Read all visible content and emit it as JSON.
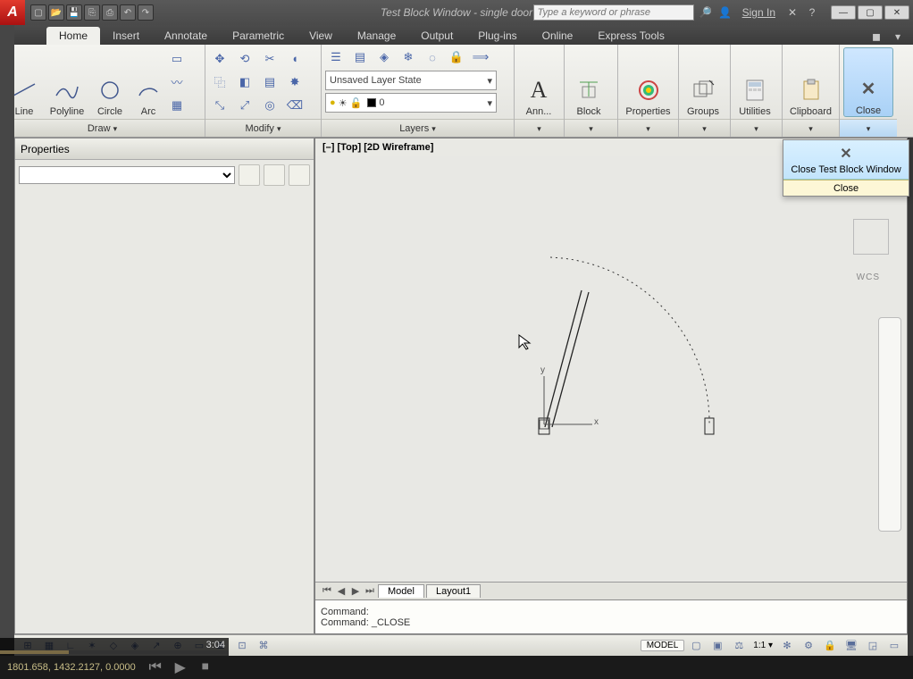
{
  "window": {
    "title": "Test Block Window - single door",
    "search_placeholder": "Type a keyword or phrase",
    "signin": "Sign In"
  },
  "tabs": {
    "items": [
      "Home",
      "Insert",
      "Annotate",
      "Parametric",
      "View",
      "Manage",
      "Output",
      "Plug-ins",
      "Online",
      "Express Tools"
    ],
    "active": 0
  },
  "ribbon": {
    "draw": {
      "title": "Draw",
      "line": "Line",
      "polyline": "Polyline",
      "circle": "Circle",
      "arc": "Arc"
    },
    "modify": {
      "title": "Modify"
    },
    "layers": {
      "title": "Layers",
      "state": "Unsaved Layer State",
      "current": "0"
    },
    "ann": {
      "title": "",
      "label": "Ann..."
    },
    "block": {
      "label": "Block"
    },
    "properties": {
      "label": "Properties"
    },
    "groups": {
      "label": "Groups"
    },
    "utilities": {
      "label": "Utilities"
    },
    "clipboard": {
      "label": "Clipboard"
    },
    "close": {
      "label": "Close"
    }
  },
  "properties_panel": {
    "title": "Properties"
  },
  "viewport": {
    "label": "[–] [Top] [2D Wireframe]",
    "x": "x",
    "y": "y",
    "wcs": "WCS"
  },
  "model_tabs": {
    "model": "Model",
    "layout1": "Layout1"
  },
  "command": {
    "line1": "Command:",
    "line2": "Command: _CLOSE"
  },
  "close_menu": {
    "dropdown": "Close Test Block Window",
    "category": "Close"
  },
  "status": {
    "model": "MODEL",
    "scale": "1:1"
  },
  "video": {
    "time": "3:04",
    "coords": "1801.658, 1432.2127, 0.0000"
  }
}
